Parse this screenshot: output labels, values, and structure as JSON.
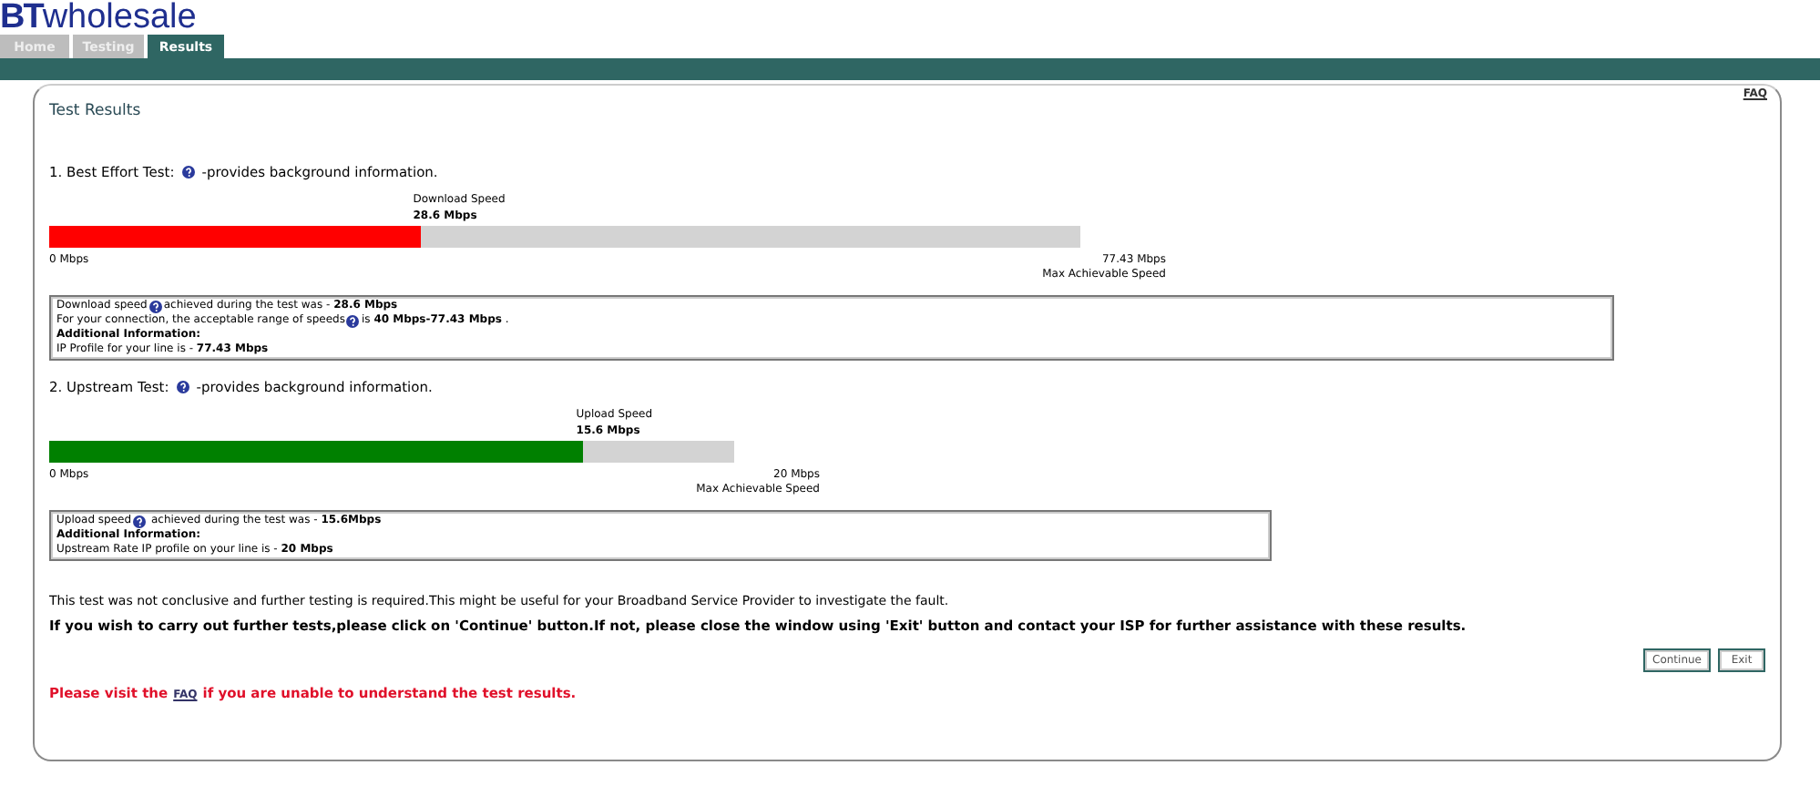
{
  "logo": {
    "brand": "BT",
    "name": "wholesale"
  },
  "tabs": [
    {
      "label": "Home",
      "selected": false
    },
    {
      "label": "Testing",
      "selected": false
    },
    {
      "label": "Results",
      "selected": true
    }
  ],
  "faq_link": "FAQ",
  "panel_title": "Test Results",
  "tests": [
    {
      "heading": "1. Best Effort Test:",
      "heading_note": "-provides background information.",
      "speed_label": "Download Speed",
      "speed_value": "28.6 Mbps",
      "level": 0.36,
      "color": "#ff0000",
      "min_label": "0 Mbps",
      "max_label": "77.43 Mbps",
      "max_caption": "Max Achievable Speed",
      "info": [
        {
          "kind": "help",
          "before": "Download speed",
          "after": "achieved during the test was - **28.6 Mbps**"
        },
        {
          "kind": "help",
          "before": "For your connection, the acceptable range of speeds",
          "after": "is **40 Mbps-77.43 Mbps** ."
        },
        {
          "kind": "heading",
          "text": "Additional Information:"
        },
        {
          "kind": "plain",
          "text": "IP Profile for your line is - **77.43 Mbps**"
        }
      ]
    },
    {
      "heading": "2. Upstream Test:",
      "heading_note": "-provides background information.",
      "speed_label": "Upload Speed",
      "speed_value": "15.6 Mbps",
      "level": 0.78,
      "color": "#008000",
      "min_label": "0 Mbps",
      "max_label": "20 Mbps",
      "max_caption": "Max Achievable Speed",
      "info": [
        {
          "kind": "help",
          "before": "Upload speed",
          "after": " achieved during the test was - **15.6Mbps**"
        },
        {
          "kind": "heading",
          "text": "Additional Information:"
        },
        {
          "kind": "plain",
          "text": "Upstream Rate IP profile on your line is - **20 Mbps**"
        }
      ]
    }
  ],
  "conclusion": "This test was not conclusive and further testing is required.This might be useful for your Broadband Service Provider to investigate the fault.",
  "instruction": "If you wish to carry out further tests,please click on 'Continue' button.If not, please close the window using 'Exit' button and contact your ISP for further assistance with these results.",
  "buttons": [
    "Continue",
    "Exit"
  ],
  "footer": {
    "before": "Please visit the",
    "link": "FAQ",
    "after": "if you are unable to understand the test results."
  }
}
